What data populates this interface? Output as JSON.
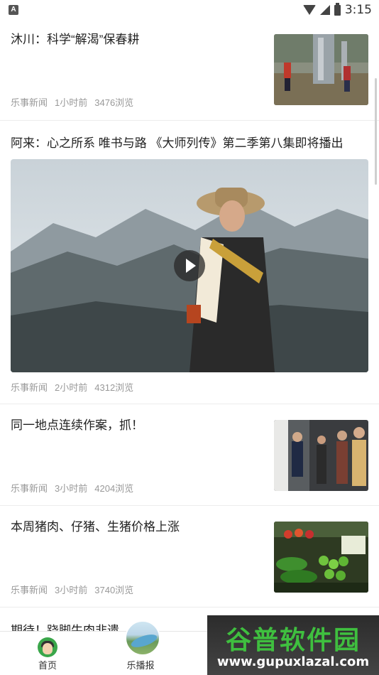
{
  "status_bar": {
    "left_badge": "A",
    "time": "3:15",
    "icons": [
      "wifi-icon",
      "signal-icon",
      "battery-icon"
    ]
  },
  "feed": [
    {
      "title": "沐川：科学“解渴”保春耕",
      "source": "乐事新闻",
      "time": "1小时前",
      "views": "3476浏览",
      "media": "thumbnail"
    },
    {
      "title": "阿来：心之所系 唯书与路 《大师列传》第二季第八集即将播出",
      "source": "乐事新闻",
      "time": "2小时前",
      "views": "4312浏览",
      "media": "video"
    },
    {
      "title": "同一地点连续作案，抓！",
      "source": "乐事新闻",
      "time": "3小时前",
      "views": "4204浏览",
      "media": "thumbnail"
    },
    {
      "title": "本周猪肉、仔猪、生猪价格上涨",
      "source": "乐事新闻",
      "time": "3小时前",
      "views": "3740浏览",
      "media": "thumbnail"
    },
    {
      "title": "期待！跷脚牛肉非遗……"
    }
  ],
  "tabbar": {
    "tabs": [
      {
        "label": "首页",
        "icon": "home-avatar-icon"
      },
      {
        "label": "乐播报",
        "icon": "broadcast-icon"
      }
    ]
  },
  "watermark": {
    "title": "谷普软件园",
    "url": "www.gupuxlazal.com"
  },
  "colors": {
    "meta_text": "#999999",
    "title_text": "#222222",
    "divider": "#ececec",
    "watermark_green": "#3fbf3f"
  }
}
